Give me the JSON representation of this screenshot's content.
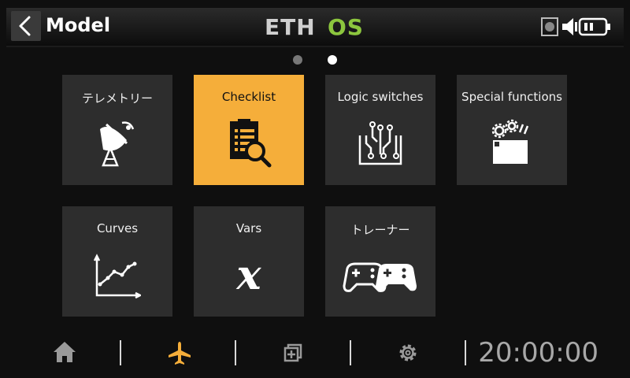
{
  "header": {
    "title": "Model",
    "brand": "ETHOS",
    "icons": [
      "back-chevron-icon",
      "sd-card-icon",
      "volume-icon",
      "battery-icon"
    ]
  },
  "pager": {
    "pages": 2,
    "current": 2
  },
  "tiles": [
    {
      "label": "テレメトリー",
      "icon": "satellite-dish-icon",
      "active": false
    },
    {
      "label": "Checklist",
      "icon": "checklist-search-icon",
      "active": true
    },
    {
      "label": "Logic switches",
      "icon": "logic-circuit-icon",
      "active": false
    },
    {
      "label": "Special functions",
      "icon": "gears-icon",
      "active": false
    },
    {
      "label": "Curves",
      "icon": "curve-graph-icon",
      "active": false
    },
    {
      "label": "Vars",
      "icon": "variable-x-icon",
      "active": false
    },
    {
      "label": "トレーナー",
      "icon": "gamepads-icon",
      "active": false
    }
  ],
  "footer": {
    "icons": [
      "home-icon",
      "airplane-icon",
      "layers-add-icon",
      "settings-gear-icon"
    ],
    "active_icon": "airplane-icon",
    "clock": "20:00:00"
  },
  "colors": {
    "accent": "#f5ae3a",
    "brand_green": "#8cc63e",
    "tile": "#2d2d2d"
  }
}
